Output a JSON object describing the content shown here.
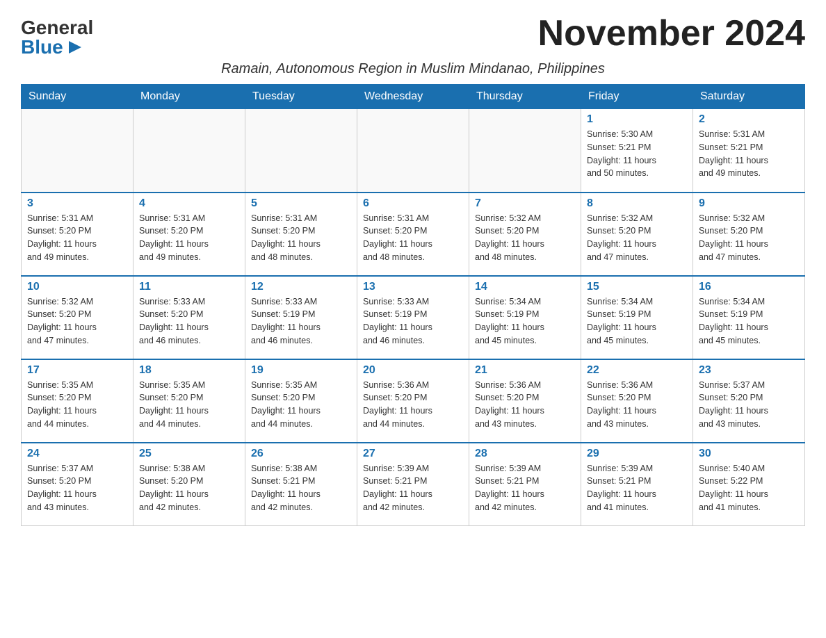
{
  "header": {
    "logo_general": "General",
    "logo_blue": "Blue",
    "month_title": "November 2024",
    "subtitle": "Ramain, Autonomous Region in Muslim Mindanao, Philippines"
  },
  "weekdays": [
    "Sunday",
    "Monday",
    "Tuesday",
    "Wednesday",
    "Thursday",
    "Friday",
    "Saturday"
  ],
  "weeks": [
    [
      {
        "day": "",
        "info": ""
      },
      {
        "day": "",
        "info": ""
      },
      {
        "day": "",
        "info": ""
      },
      {
        "day": "",
        "info": ""
      },
      {
        "day": "",
        "info": ""
      },
      {
        "day": "1",
        "info": "Sunrise: 5:30 AM\nSunset: 5:21 PM\nDaylight: 11 hours\nand 50 minutes."
      },
      {
        "day": "2",
        "info": "Sunrise: 5:31 AM\nSunset: 5:21 PM\nDaylight: 11 hours\nand 49 minutes."
      }
    ],
    [
      {
        "day": "3",
        "info": "Sunrise: 5:31 AM\nSunset: 5:20 PM\nDaylight: 11 hours\nand 49 minutes."
      },
      {
        "day": "4",
        "info": "Sunrise: 5:31 AM\nSunset: 5:20 PM\nDaylight: 11 hours\nand 49 minutes."
      },
      {
        "day": "5",
        "info": "Sunrise: 5:31 AM\nSunset: 5:20 PM\nDaylight: 11 hours\nand 48 minutes."
      },
      {
        "day": "6",
        "info": "Sunrise: 5:31 AM\nSunset: 5:20 PM\nDaylight: 11 hours\nand 48 minutes."
      },
      {
        "day": "7",
        "info": "Sunrise: 5:32 AM\nSunset: 5:20 PM\nDaylight: 11 hours\nand 48 minutes."
      },
      {
        "day": "8",
        "info": "Sunrise: 5:32 AM\nSunset: 5:20 PM\nDaylight: 11 hours\nand 47 minutes."
      },
      {
        "day": "9",
        "info": "Sunrise: 5:32 AM\nSunset: 5:20 PM\nDaylight: 11 hours\nand 47 minutes."
      }
    ],
    [
      {
        "day": "10",
        "info": "Sunrise: 5:32 AM\nSunset: 5:20 PM\nDaylight: 11 hours\nand 47 minutes."
      },
      {
        "day": "11",
        "info": "Sunrise: 5:33 AM\nSunset: 5:20 PM\nDaylight: 11 hours\nand 46 minutes."
      },
      {
        "day": "12",
        "info": "Sunrise: 5:33 AM\nSunset: 5:19 PM\nDaylight: 11 hours\nand 46 minutes."
      },
      {
        "day": "13",
        "info": "Sunrise: 5:33 AM\nSunset: 5:19 PM\nDaylight: 11 hours\nand 46 minutes."
      },
      {
        "day": "14",
        "info": "Sunrise: 5:34 AM\nSunset: 5:19 PM\nDaylight: 11 hours\nand 45 minutes."
      },
      {
        "day": "15",
        "info": "Sunrise: 5:34 AM\nSunset: 5:19 PM\nDaylight: 11 hours\nand 45 minutes."
      },
      {
        "day": "16",
        "info": "Sunrise: 5:34 AM\nSunset: 5:19 PM\nDaylight: 11 hours\nand 45 minutes."
      }
    ],
    [
      {
        "day": "17",
        "info": "Sunrise: 5:35 AM\nSunset: 5:20 PM\nDaylight: 11 hours\nand 44 minutes."
      },
      {
        "day": "18",
        "info": "Sunrise: 5:35 AM\nSunset: 5:20 PM\nDaylight: 11 hours\nand 44 minutes."
      },
      {
        "day": "19",
        "info": "Sunrise: 5:35 AM\nSunset: 5:20 PM\nDaylight: 11 hours\nand 44 minutes."
      },
      {
        "day": "20",
        "info": "Sunrise: 5:36 AM\nSunset: 5:20 PM\nDaylight: 11 hours\nand 44 minutes."
      },
      {
        "day": "21",
        "info": "Sunrise: 5:36 AM\nSunset: 5:20 PM\nDaylight: 11 hours\nand 43 minutes."
      },
      {
        "day": "22",
        "info": "Sunrise: 5:36 AM\nSunset: 5:20 PM\nDaylight: 11 hours\nand 43 minutes."
      },
      {
        "day": "23",
        "info": "Sunrise: 5:37 AM\nSunset: 5:20 PM\nDaylight: 11 hours\nand 43 minutes."
      }
    ],
    [
      {
        "day": "24",
        "info": "Sunrise: 5:37 AM\nSunset: 5:20 PM\nDaylight: 11 hours\nand 43 minutes."
      },
      {
        "day": "25",
        "info": "Sunrise: 5:38 AM\nSunset: 5:20 PM\nDaylight: 11 hours\nand 42 minutes."
      },
      {
        "day": "26",
        "info": "Sunrise: 5:38 AM\nSunset: 5:21 PM\nDaylight: 11 hours\nand 42 minutes."
      },
      {
        "day": "27",
        "info": "Sunrise: 5:39 AM\nSunset: 5:21 PM\nDaylight: 11 hours\nand 42 minutes."
      },
      {
        "day": "28",
        "info": "Sunrise: 5:39 AM\nSunset: 5:21 PM\nDaylight: 11 hours\nand 42 minutes."
      },
      {
        "day": "29",
        "info": "Sunrise: 5:39 AM\nSunset: 5:21 PM\nDaylight: 11 hours\nand 41 minutes."
      },
      {
        "day": "30",
        "info": "Sunrise: 5:40 AM\nSunset: 5:22 PM\nDaylight: 11 hours\nand 41 minutes."
      }
    ]
  ]
}
